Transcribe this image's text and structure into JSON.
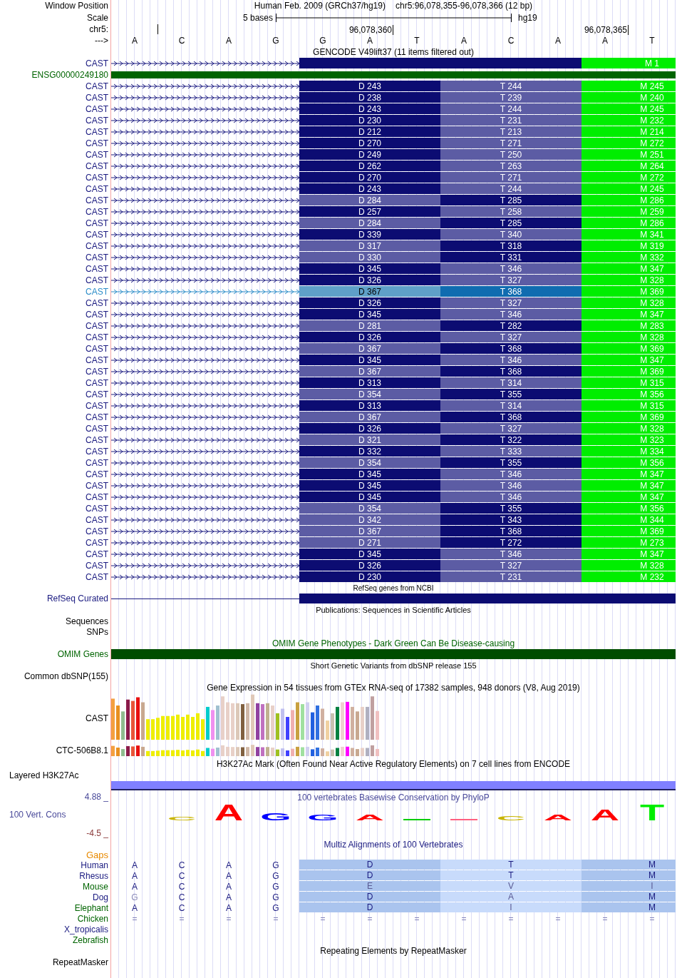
{
  "header": {
    "window_position_label": "Window Position",
    "assembly": "Human Feb. 2009 (GRCh37/hg19)",
    "position": "chr5:96,078,355-96,078,366 (12 bp)",
    "scale_label": "Scale",
    "scale_span": "5 bases",
    "scale_db": "hg19",
    "chrom_label": "chr5:",
    "ticks": [
      "96,078,360",
      "96,078,365"
    ],
    "strand_label": "--->",
    "bases": [
      "A",
      "C",
      "A",
      "G",
      "G",
      "A",
      "T",
      "A",
      "C",
      "A",
      "A",
      "T"
    ]
  },
  "gencode": {
    "title": "GENCODE V49lift37 (11 items filtered out)",
    "partial": {
      "label": "CAST",
      "exons": [
        {
          "text": "M 1",
          "color": "#00ee00"
        }
      ]
    },
    "gene": {
      "label": "ENSG00000249180"
    },
    "transcripts": [
      {
        "label": "CAST",
        "highlighted": false,
        "exons": [
          {
            "text": "D 243",
            "color": "#0c0c72"
          },
          {
            "text": "T 244",
            "color": "#5c5ca4"
          },
          {
            "text": "M 245",
            "color": "#00ee00"
          }
        ]
      },
      {
        "label": "CAST",
        "highlighted": false,
        "exons": [
          {
            "text": "D 238",
            "color": "#0c0c72"
          },
          {
            "text": "T 239",
            "color": "#5c5ca4"
          },
          {
            "text": "M 240",
            "color": "#00ee00"
          }
        ]
      },
      {
        "label": "CAST",
        "highlighted": false,
        "exons": [
          {
            "text": "D 243",
            "color": "#0c0c72"
          },
          {
            "text": "T 244",
            "color": "#5c5ca4"
          },
          {
            "text": "M 245",
            "color": "#00ee00"
          }
        ]
      },
      {
        "label": "CAST",
        "highlighted": false,
        "exons": [
          {
            "text": "D 230",
            "color": "#0c0c72"
          },
          {
            "text": "T 231",
            "color": "#5c5ca4"
          },
          {
            "text": "M 232",
            "color": "#00ee00"
          }
        ]
      },
      {
        "label": "CAST",
        "highlighted": false,
        "exons": [
          {
            "text": "D 212",
            "color": "#0c0c72"
          },
          {
            "text": "T 213",
            "color": "#5c5ca4"
          },
          {
            "text": "M 214",
            "color": "#00ee00"
          }
        ]
      },
      {
        "label": "CAST",
        "highlighted": false,
        "exons": [
          {
            "text": "D 270",
            "color": "#0c0c72"
          },
          {
            "text": "T 271",
            "color": "#5c5ca4"
          },
          {
            "text": "M 272",
            "color": "#00ee00"
          }
        ]
      },
      {
        "label": "CAST",
        "highlighted": false,
        "exons": [
          {
            "text": "D 249",
            "color": "#0c0c72"
          },
          {
            "text": "T 250",
            "color": "#5c5ca4"
          },
          {
            "text": "M 251",
            "color": "#00ee00"
          }
        ]
      },
      {
        "label": "CAST",
        "highlighted": false,
        "exons": [
          {
            "text": "D 262",
            "color": "#0c0c72"
          },
          {
            "text": "T 263",
            "color": "#5c5ca4"
          },
          {
            "text": "M 264",
            "color": "#00ee00"
          }
        ]
      },
      {
        "label": "CAST",
        "highlighted": false,
        "exons": [
          {
            "text": "D 270",
            "color": "#0c0c72"
          },
          {
            "text": "T 271",
            "color": "#5c5ca4"
          },
          {
            "text": "M 272",
            "color": "#00ee00"
          }
        ]
      },
      {
        "label": "CAST",
        "highlighted": false,
        "exons": [
          {
            "text": "D 243",
            "color": "#0c0c72"
          },
          {
            "text": "T 244",
            "color": "#5c5ca4"
          },
          {
            "text": "M 245",
            "color": "#00ee00"
          }
        ]
      },
      {
        "label": "CAST",
        "highlighted": false,
        "exons": [
          {
            "text": "D 284",
            "color": "#5c5ca4"
          },
          {
            "text": "T 285",
            "color": "#0c0c72"
          },
          {
            "text": "M 286",
            "color": "#00ee00"
          }
        ]
      },
      {
        "label": "CAST",
        "highlighted": false,
        "exons": [
          {
            "text": "D 257",
            "color": "#0c0c72"
          },
          {
            "text": "T 258",
            "color": "#5c5ca4"
          },
          {
            "text": "M 259",
            "color": "#00ee00"
          }
        ]
      },
      {
        "label": "CAST",
        "highlighted": false,
        "exons": [
          {
            "text": "D 284",
            "color": "#5c5ca4"
          },
          {
            "text": "T 285",
            "color": "#0c0c72"
          },
          {
            "text": "M 286",
            "color": "#00ee00"
          }
        ]
      },
      {
        "label": "CAST",
        "highlighted": false,
        "exons": [
          {
            "text": "D 339",
            "color": "#0c0c72"
          },
          {
            "text": "T 340",
            "color": "#5c5ca4"
          },
          {
            "text": "M 341",
            "color": "#00ee00"
          }
        ]
      },
      {
        "label": "CAST",
        "highlighted": false,
        "exons": [
          {
            "text": "D 317",
            "color": "#5c5ca4"
          },
          {
            "text": "T 318",
            "color": "#0c0c72"
          },
          {
            "text": "M 319",
            "color": "#00ee00"
          }
        ]
      },
      {
        "label": "CAST",
        "highlighted": false,
        "exons": [
          {
            "text": "D 330",
            "color": "#5c5ca4"
          },
          {
            "text": "T 331",
            "color": "#0c0c72"
          },
          {
            "text": "M 332",
            "color": "#00ee00"
          }
        ]
      },
      {
        "label": "CAST",
        "highlighted": false,
        "exons": [
          {
            "text": "D 345",
            "color": "#0c0c72"
          },
          {
            "text": "T 346",
            "color": "#5c5ca4"
          },
          {
            "text": "M 347",
            "color": "#00ee00"
          }
        ]
      },
      {
        "label": "CAST",
        "highlighted": false,
        "exons": [
          {
            "text": "D 326",
            "color": "#0c0c72"
          },
          {
            "text": "T 327",
            "color": "#5c5ca4"
          },
          {
            "text": "M 328",
            "color": "#00ee00"
          }
        ]
      },
      {
        "label": "CAST",
        "highlighted": true,
        "exons": [
          {
            "text": "D 367",
            "color": "#5fa0c8"
          },
          {
            "text": "T 368",
            "color": "#106cb0"
          },
          {
            "text": "M 369",
            "color": "#00ee00"
          }
        ]
      },
      {
        "label": "CAST",
        "highlighted": false,
        "exons": [
          {
            "text": "D 326",
            "color": "#0c0c72"
          },
          {
            "text": "T 327",
            "color": "#5c5ca4"
          },
          {
            "text": "M 328",
            "color": "#00ee00"
          }
        ]
      },
      {
        "label": "CAST",
        "highlighted": false,
        "exons": [
          {
            "text": "D 345",
            "color": "#0c0c72"
          },
          {
            "text": "T 346",
            "color": "#5c5ca4"
          },
          {
            "text": "M 347",
            "color": "#00ee00"
          }
        ]
      },
      {
        "label": "CAST",
        "highlighted": false,
        "exons": [
          {
            "text": "D 281",
            "color": "#5c5ca4"
          },
          {
            "text": "T 282",
            "color": "#0c0c72"
          },
          {
            "text": "M 283",
            "color": "#00ee00"
          }
        ]
      },
      {
        "label": "CAST",
        "highlighted": false,
        "exons": [
          {
            "text": "D 326",
            "color": "#0c0c72"
          },
          {
            "text": "T 327",
            "color": "#5c5ca4"
          },
          {
            "text": "M 328",
            "color": "#00ee00"
          }
        ]
      },
      {
        "label": "CAST",
        "highlighted": false,
        "exons": [
          {
            "text": "D 367",
            "color": "#5c5ca4"
          },
          {
            "text": "T 368",
            "color": "#0c0c72"
          },
          {
            "text": "M 369",
            "color": "#00ee00"
          }
        ]
      },
      {
        "label": "CAST",
        "highlighted": false,
        "exons": [
          {
            "text": "D 345",
            "color": "#0c0c72"
          },
          {
            "text": "T 346",
            "color": "#5c5ca4"
          },
          {
            "text": "M 347",
            "color": "#00ee00"
          }
        ]
      },
      {
        "label": "CAST",
        "highlighted": false,
        "exons": [
          {
            "text": "D 367",
            "color": "#5c5ca4"
          },
          {
            "text": "T 368",
            "color": "#0c0c72"
          },
          {
            "text": "M 369",
            "color": "#00ee00"
          }
        ]
      },
      {
        "label": "CAST",
        "highlighted": false,
        "exons": [
          {
            "text": "D 313",
            "color": "#0c0c72"
          },
          {
            "text": "T 314",
            "color": "#5c5ca4"
          },
          {
            "text": "M 315",
            "color": "#00ee00"
          }
        ]
      },
      {
        "label": "CAST",
        "highlighted": false,
        "exons": [
          {
            "text": "D 354",
            "color": "#5c5ca4"
          },
          {
            "text": "T 355",
            "color": "#0c0c72"
          },
          {
            "text": "M 356",
            "color": "#00ee00"
          }
        ]
      },
      {
        "label": "CAST",
        "highlighted": false,
        "exons": [
          {
            "text": "D 313",
            "color": "#0c0c72"
          },
          {
            "text": "T 314",
            "color": "#5c5ca4"
          },
          {
            "text": "M 315",
            "color": "#00ee00"
          }
        ]
      },
      {
        "label": "CAST",
        "highlighted": false,
        "exons": [
          {
            "text": "D 367",
            "color": "#5c5ca4"
          },
          {
            "text": "T 368",
            "color": "#0c0c72"
          },
          {
            "text": "M 369",
            "color": "#00ee00"
          }
        ]
      },
      {
        "label": "CAST",
        "highlighted": false,
        "exons": [
          {
            "text": "D 326",
            "color": "#0c0c72"
          },
          {
            "text": "T 327",
            "color": "#5c5ca4"
          },
          {
            "text": "M 328",
            "color": "#00ee00"
          }
        ]
      },
      {
        "label": "CAST",
        "highlighted": false,
        "exons": [
          {
            "text": "D 321",
            "color": "#5c5ca4"
          },
          {
            "text": "T 322",
            "color": "#0c0c72"
          },
          {
            "text": "M 323",
            "color": "#00ee00"
          }
        ]
      },
      {
        "label": "CAST",
        "highlighted": false,
        "exons": [
          {
            "text": "D 332",
            "color": "#0c0c72"
          },
          {
            "text": "T 333",
            "color": "#5c5ca4"
          },
          {
            "text": "M 334",
            "color": "#00ee00"
          }
        ]
      },
      {
        "label": "CAST",
        "highlighted": false,
        "exons": [
          {
            "text": "D 354",
            "color": "#5c5ca4"
          },
          {
            "text": "T 355",
            "color": "#0c0c72"
          },
          {
            "text": "M 356",
            "color": "#00ee00"
          }
        ]
      },
      {
        "label": "CAST",
        "highlighted": false,
        "exons": [
          {
            "text": "D 345",
            "color": "#0c0c72"
          },
          {
            "text": "T 346",
            "color": "#5c5ca4"
          },
          {
            "text": "M 347",
            "color": "#00ee00"
          }
        ]
      },
      {
        "label": "CAST",
        "highlighted": false,
        "exons": [
          {
            "text": "D 345",
            "color": "#0c0c72"
          },
          {
            "text": "T 346",
            "color": "#5c5ca4"
          },
          {
            "text": "M 347",
            "color": "#00ee00"
          }
        ]
      },
      {
        "label": "CAST",
        "highlighted": false,
        "exons": [
          {
            "text": "D 345",
            "color": "#0c0c72"
          },
          {
            "text": "T 346",
            "color": "#5c5ca4"
          },
          {
            "text": "M 347",
            "color": "#00ee00"
          }
        ]
      },
      {
        "label": "CAST",
        "highlighted": false,
        "exons": [
          {
            "text": "D 354",
            "color": "#5c5ca4"
          },
          {
            "text": "T 355",
            "color": "#0c0c72"
          },
          {
            "text": "M 356",
            "color": "#00ee00"
          }
        ]
      },
      {
        "label": "CAST",
        "highlighted": false,
        "exons": [
          {
            "text": "D 342",
            "color": "#5c5ca4"
          },
          {
            "text": "T 343",
            "color": "#0c0c72"
          },
          {
            "text": "M 344",
            "color": "#00ee00"
          }
        ]
      },
      {
        "label": "CAST",
        "highlighted": false,
        "exons": [
          {
            "text": "D 367",
            "color": "#5c5ca4"
          },
          {
            "text": "T 368",
            "color": "#0c0c72"
          },
          {
            "text": "M 369",
            "color": "#00ee00"
          }
        ]
      },
      {
        "label": "CAST",
        "highlighted": false,
        "exons": [
          {
            "text": "D 271",
            "color": "#5c5ca4"
          },
          {
            "text": "T 272",
            "color": "#0c0c72"
          },
          {
            "text": "M 273",
            "color": "#00ee00"
          }
        ]
      },
      {
        "label": "CAST",
        "highlighted": false,
        "exons": [
          {
            "text": "D 345",
            "color": "#0c0c72"
          },
          {
            "text": "T 346",
            "color": "#5c5ca4"
          },
          {
            "text": "M 347",
            "color": "#00ee00"
          }
        ]
      },
      {
        "label": "CAST",
        "highlighted": false,
        "exons": [
          {
            "text": "D 326",
            "color": "#0c0c72"
          },
          {
            "text": "T 327",
            "color": "#5c5ca4"
          },
          {
            "text": "M 328",
            "color": "#00ee00"
          }
        ]
      },
      {
        "label": "CAST",
        "highlighted": false,
        "exons": [
          {
            "text": "D 230",
            "color": "#0c0c72"
          },
          {
            "text": "T 231",
            "color": "#5c5ca4"
          },
          {
            "text": "M 232",
            "color": "#00ee00"
          }
        ]
      }
    ]
  },
  "refseq": {
    "title": "RefSeq genes from NCBI",
    "label": "RefSeq Curated"
  },
  "publications": {
    "title": "Publications: Sequences in Scientific Articles",
    "labels": [
      "Sequences",
      "SNPs"
    ]
  },
  "omim": {
    "title": "OMIM Gene Phenotypes - Dark Green Can Be Disease-causing",
    "label": "OMIM Genes"
  },
  "dbsnp": {
    "title": "Short Genetic Variants from dbSNP release 155",
    "label": "Common dbSNP(155)"
  },
  "gtex": {
    "title": "Gene Expression in 54 tissues from GTEx RNA-seq of 17382 samples, 948 donors (V8, Aug 2019)",
    "genes": [
      "CAST",
      "CTC-506B8.1"
    ]
  },
  "h3k27ac": {
    "title": "H3K27Ac Mark (Often Found Near Active Regulatory Elements) on 7 cell lines from ENCODE",
    "label": "Layered H3K27Ac"
  },
  "conservation": {
    "title": "100 vertebrates Basewise Conservation by PhyloP",
    "label": "100 Vert. Cons",
    "max": "4.88 _",
    "min": "-4.5 _",
    "letters": [
      {
        "text": "C",
        "color": "#c8b400"
      },
      {
        "text": "A",
        "color": "#ff0000"
      },
      {
        "text": "G",
        "color": "#0000ff"
      },
      {
        "text": "G",
        "color": "#0000ff"
      },
      {
        "text": "A",
        "color": "#ff0000"
      },
      {
        "text": "C",
        "color": "#c8b400"
      },
      {
        "text": "A",
        "color": "#ff0000"
      },
      {
        "text": "A",
        "color": "#ff0000"
      },
      {
        "text": "T",
        "color": "#00ee00"
      }
    ]
  },
  "multiz": {
    "title": "Multiz Alignments of 100 Vertebrates",
    "gaps_label": "Gaps",
    "species": [
      {
        "name": "Human",
        "color": "#1a1a80",
        "kind": "codons",
        "cells": [
          {
            "text": "A",
            "match": true
          },
          {
            "text": "C",
            "match": true
          },
          {
            "text": "A",
            "match": true
          },
          {
            "text": "G",
            "match": true
          },
          {
            "text": "D",
            "match": true
          },
          {
            "text": "T",
            "match": true
          },
          {
            "text": "M",
            "match": true
          }
        ]
      },
      {
        "name": "Rhesus",
        "color": "#1a1a80",
        "kind": "codons",
        "cells": [
          {
            "text": "A",
            "match": true
          },
          {
            "text": "C",
            "match": true
          },
          {
            "text": "A",
            "match": true
          },
          {
            "text": "G",
            "match": true
          },
          {
            "text": "D",
            "match": true
          },
          {
            "text": "T",
            "match": true
          },
          {
            "text": "M",
            "match": true
          }
        ]
      },
      {
        "name": "Mouse",
        "color": "#006400",
        "kind": "codons",
        "cells": [
          {
            "text": "A",
            "match": true
          },
          {
            "text": "C",
            "match": true
          },
          {
            "text": "A",
            "match": true
          },
          {
            "text": "G",
            "match": true
          },
          {
            "text": "E",
            "match": false
          },
          {
            "text": "V",
            "match": false
          },
          {
            "text": "I",
            "match": false
          }
        ]
      },
      {
        "name": "Dog",
        "color": "#1a1a80",
        "kind": "codons",
        "cells": [
          {
            "text": "G",
            "match": false
          },
          {
            "text": "C",
            "match": true
          },
          {
            "text": "A",
            "match": true
          },
          {
            "text": "G",
            "match": true
          },
          {
            "text": "D",
            "match": true
          },
          {
            "text": "A",
            "match": false
          },
          {
            "text": "M",
            "match": true
          }
        ]
      },
      {
        "name": "Elephant",
        "color": "#006400",
        "kind": "codons",
        "cells": [
          {
            "text": "A",
            "match": true
          },
          {
            "text": "C",
            "match": true
          },
          {
            "text": "A",
            "match": true
          },
          {
            "text": "G",
            "match": true
          },
          {
            "text": "D",
            "match": true
          },
          {
            "text": "I",
            "match": false
          },
          {
            "text": "M",
            "match": true
          }
        ]
      },
      {
        "name": "Chicken",
        "color": "#006400",
        "kind": "gaps",
        "cells": [
          {
            "text": "="
          },
          {
            "text": "="
          },
          {
            "text": "="
          },
          {
            "text": "="
          },
          {
            "text": "="
          },
          {
            "text": "="
          },
          {
            "text": "="
          },
          {
            "text": "="
          },
          {
            "text": "="
          },
          {
            "text": "="
          },
          {
            "text": "="
          },
          {
            "text": "="
          }
        ]
      },
      {
        "name": "X_tropicalis",
        "color": "#1a1a80",
        "kind": "none"
      },
      {
        "name": "Zebrafish",
        "color": "#006400",
        "kind": "none"
      }
    ]
  },
  "repeatmasker": {
    "title": "Repeating Elements by RepeatMasker",
    "label": "RepeatMasker"
  }
}
